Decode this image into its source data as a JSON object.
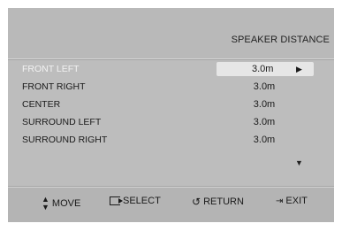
{
  "menu": {
    "title": "SPEAKER DISTANCE",
    "rows": [
      {
        "label": "FRONT LEFT",
        "value": "3.0m"
      },
      {
        "label": "FRONT RIGHT",
        "value": "3.0m"
      },
      {
        "label": "CENTER",
        "value": "3.0m"
      },
      {
        "label": "SURROUND LEFT",
        "value": "3.0m"
      },
      {
        "label": "SURROUND RIGHT",
        "value": "3.0m"
      }
    ],
    "selected_index": 0
  },
  "footer": {
    "move_label": "MOVE",
    "select_label": "SELECT",
    "return_label": "RETURN",
    "exit_label": "EXIT"
  },
  "icons": {
    "right": "play-right-icon",
    "down": "scroll-down-icon",
    "move": "up-down-arrows-icon",
    "select": "enter-icon",
    "return": "return-icon",
    "exit": "exit-icon"
  }
}
